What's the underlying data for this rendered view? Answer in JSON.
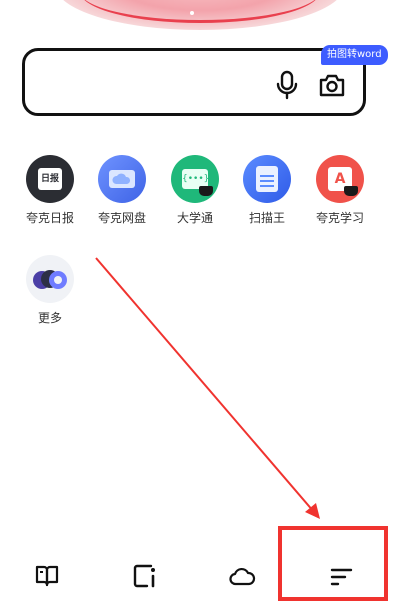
{
  "search": {
    "photo_to_word_badge": "拍图转word",
    "mic_icon": "microphone-icon",
    "camera_icon": "camera-icon"
  },
  "apps": [
    {
      "label": "夸克日报",
      "icon": "daily-news-icon",
      "glyph": "日报"
    },
    {
      "label": "夸克网盘",
      "icon": "cloud-drive-icon"
    },
    {
      "label": "大学通",
      "icon": "university-icon",
      "glyph": "{•••}"
    },
    {
      "label": "扫描王",
      "icon": "scanner-icon"
    },
    {
      "label": "夸克学习",
      "icon": "study-icon",
      "glyph": "A"
    },
    {
      "label": "更多",
      "icon": "more-apps-icon"
    }
  ],
  "tabbar": [
    {
      "icon": "book-icon"
    },
    {
      "icon": "tabs-window-icon"
    },
    {
      "icon": "cloud-icon"
    },
    {
      "icon": "menu-lines-icon"
    }
  ],
  "annotation": {
    "color": "#f0332f"
  },
  "colors": {
    "badge": "#3d5cff",
    "hero_red": "#e9404e"
  }
}
